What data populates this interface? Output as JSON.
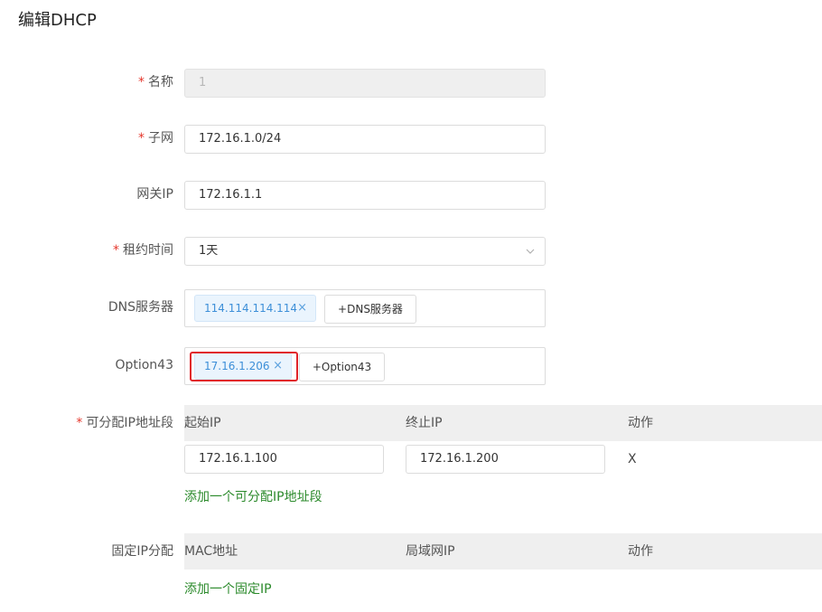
{
  "page": {
    "title": "编辑DHCP"
  },
  "form": {
    "required_mark": "*",
    "name": {
      "label": "名称",
      "value": "1"
    },
    "subnet": {
      "label": "子网",
      "value": "172.16.1.0/24"
    },
    "gateway": {
      "label": "网关IP",
      "value": "172.16.1.1"
    },
    "lease": {
      "label": "租约时间",
      "value": "1天",
      "icon": "chevron-down-icon"
    },
    "dns": {
      "label": "DNS服务器",
      "tags": [
        "114.114.114.114"
      ],
      "add_label": "+DNS服务器"
    },
    "option43": {
      "label": "Option43",
      "tags": [
        "17.16.1.206"
      ],
      "add_label": "+Option43",
      "highlight_color": "#e0232a"
    },
    "ranges": {
      "label": "可分配IP地址段",
      "headers": [
        "起始IP",
        "终止IP",
        "动作"
      ],
      "rows": [
        {
          "start": "172.16.1.100",
          "end": "172.16.1.200",
          "action": "X"
        }
      ],
      "add_link": "添加一个可分配IP地址段"
    },
    "fixed": {
      "label": "固定IP分配",
      "headers": [
        "MAC地址",
        "局域网IP",
        "动作"
      ],
      "add_link": "添加一个固定IP"
    },
    "tag_close": "×"
  },
  "colors": {
    "required": "#e5362b",
    "link": "#2b8a2b",
    "tag_text": "#3d8fd8",
    "tag_bg": "#eaf4fd"
  }
}
